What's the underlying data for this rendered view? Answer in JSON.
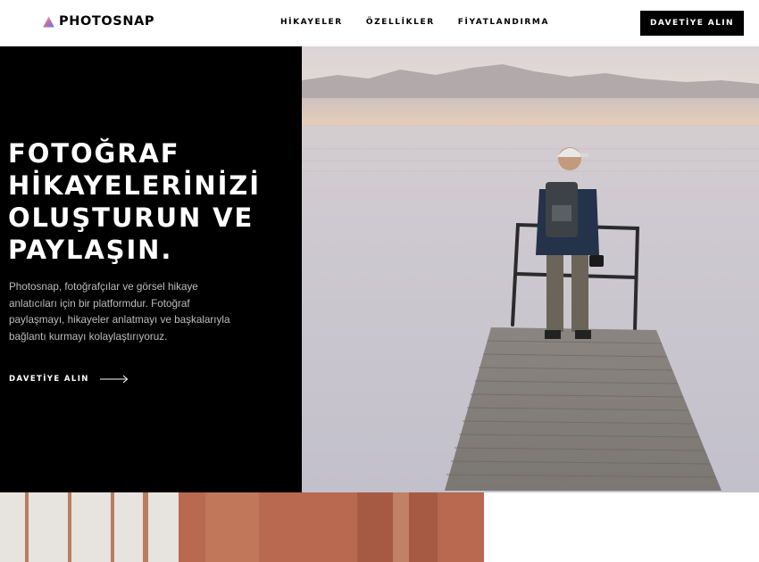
{
  "header": {
    "brand": "PHOTOSNAP",
    "logo_icon": "triangle-logo-icon",
    "nav": [
      {
        "label": "HİKAYELER"
      },
      {
        "label": "ÖZELLİKLER"
      },
      {
        "label": "FİYATLANDIRMA"
      }
    ],
    "cta_label": "DAVETİYE ALIN"
  },
  "hero": {
    "title_lines": [
      "FOTOĞRAF",
      "HİKAYELERİNİZİ",
      "OLUŞTURUN VE",
      "PAYLAŞIN."
    ],
    "description": "Photosnap, fotoğrafçılar ve görsel hikaye anlatıcıları için bir platformdur. Fotoğraf paylaşmayı, hikayeler anlatmayı ve başkalarıyla bağlantı kurmayı kolaylaştırıyoruz.",
    "cta_label": "DAVETİYE ALIN",
    "cta_icon": "arrow-right-icon",
    "image_subject": "man-on-pier-lake-photo"
  },
  "colors": {
    "brand_black": "#000000",
    "text_muted": "#bdbdbd",
    "gradient": [
      "#FFC593",
      "#BC7198",
      "#5A77FF"
    ]
  }
}
